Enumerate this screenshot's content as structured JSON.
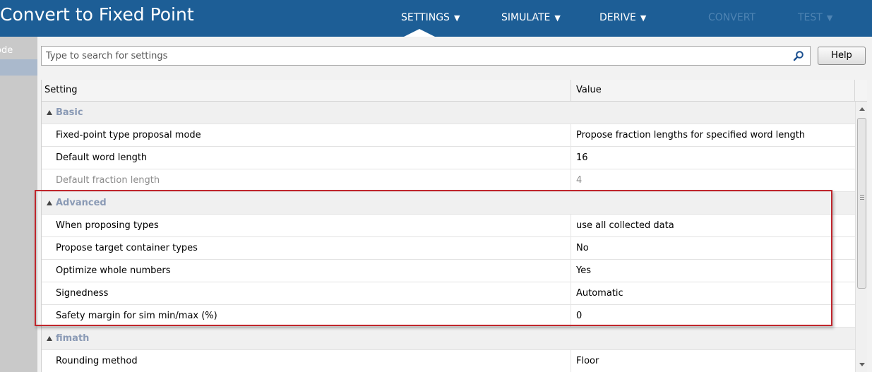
{
  "app": {
    "title": "Convert to Fixed Point"
  },
  "menu": {
    "settings": "SETTINGS",
    "simulate": "SIMULATE",
    "derive": "DERIVE",
    "convert": "CONVERT",
    "test": "TEST",
    "caret": "▼"
  },
  "left_panel": {
    "label": "ode"
  },
  "search": {
    "placeholder": "Type to search for settings",
    "value": "",
    "icon": "search-icon"
  },
  "help_button": {
    "label": "Help"
  },
  "table": {
    "headers": {
      "setting": "Setting",
      "value": "Value"
    },
    "groups": [
      {
        "name": "Basic",
        "rows": [
          {
            "setting": "Fixed-point type proposal mode",
            "value": "Propose fraction lengths for specified word length",
            "enabled": true
          },
          {
            "setting": "Default word length",
            "value": "16",
            "enabled": true
          },
          {
            "setting": "Default fraction length",
            "value": "4",
            "enabled": false
          }
        ]
      },
      {
        "name": "Advanced",
        "highlighted": true,
        "rows": [
          {
            "setting": "When proposing types",
            "value": "use all collected data",
            "enabled": true
          },
          {
            "setting": "Propose target container types",
            "value": "No",
            "enabled": true
          },
          {
            "setting": "Optimize whole numbers",
            "value": "Yes",
            "enabled": true
          },
          {
            "setting": "Signedness",
            "value": "Automatic",
            "enabled": true
          },
          {
            "setting": "Safety margin for sim min/max (%)",
            "value": "0",
            "enabled": true
          }
        ]
      },
      {
        "name": "fimath",
        "rows": [
          {
            "setting": "Rounding method",
            "value": "Floor",
            "enabled": true
          }
        ]
      }
    ]
  },
  "colors": {
    "topbar": "#1d5e96",
    "highlight": "#c0262c",
    "group_label": "#8a9ab5"
  }
}
